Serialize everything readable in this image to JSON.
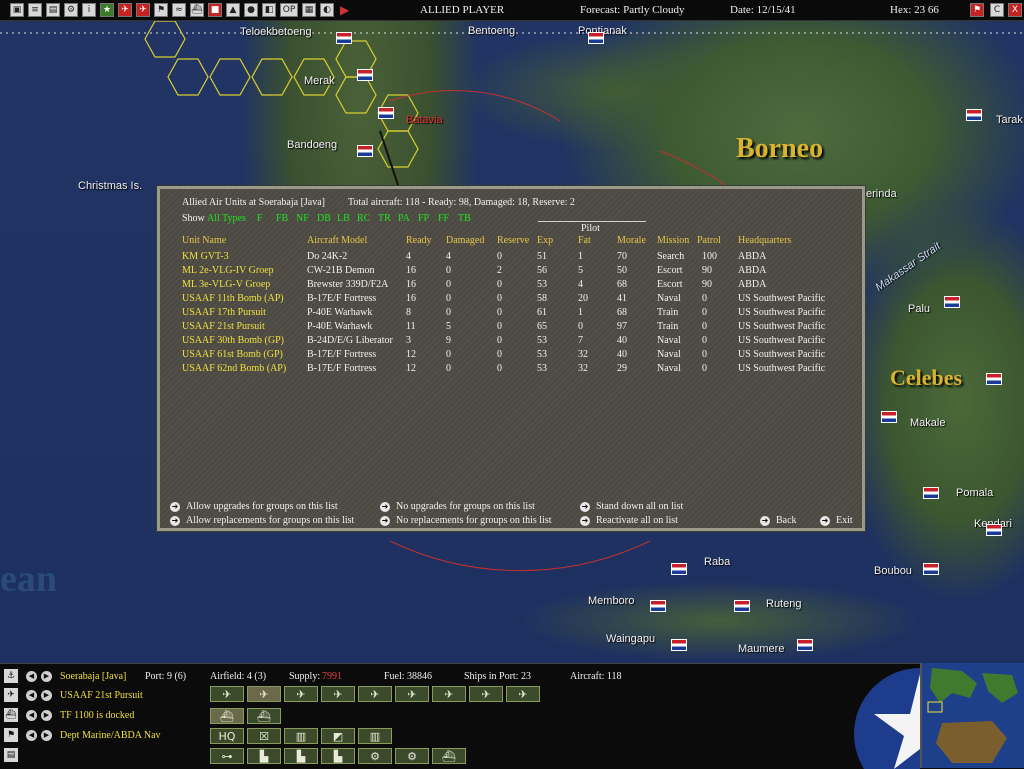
{
  "topbar": {
    "player": "ALLIED PLAYER",
    "forecast": "Forecast: Partly Cloudy",
    "date": "Date: 12/15/41",
    "hex": "Hex: 23 66",
    "corner_buttons": [
      "C",
      "X"
    ]
  },
  "map": {
    "places": [
      "Teloekbetoeng",
      "Bentoeng",
      "Pontianak",
      "Merak",
      "Batavia",
      "Bandoeng",
      "Christmas Is.",
      "Tarak",
      "Palu",
      "Makale",
      "Pomala",
      "Kendari",
      "Boubou",
      "Raba",
      "Memboro",
      "Ruteng",
      "Waingapu",
      "Maumere",
      "erinda",
      "Makassar Strait"
    ],
    "big_labels": [
      "Borneo",
      "Celebes",
      "ean"
    ]
  },
  "dialog": {
    "title": "Allied Air Units at Soerabaja [Java]",
    "totals": "Total aircraft: 118 - Ready: 98, Damaged: 18, Reserve: 2",
    "show_label": "Show",
    "filters": [
      "All Types",
      "F",
      "FB",
      "NF",
      "DB",
      "LB",
      "RC",
      "TR",
      "PA",
      "FP",
      "FF",
      "TB"
    ],
    "pilot_group": "Pilot",
    "columns": [
      "Unit Name",
      "Aircraft Model",
      "Ready",
      "Damaged",
      "Reserve",
      "Exp",
      "Fat",
      "Morale",
      "Mission",
      "Patrol",
      "Headquarters"
    ],
    "rows": [
      [
        "KM GVT-3",
        "Do 24K-2",
        "4",
        "4",
        "0",
        "51",
        "1",
        "70",
        "Search",
        "100",
        "ABDA"
      ],
      [
        "ML 2e-VLG-IV Groep",
        "CW-21B Demon",
        "16",
        "0",
        "2",
        "56",
        "5",
        "50",
        "Escort",
        "90",
        "ABDA"
      ],
      [
        "ML 3e-VLG-V Groep",
        "Brewster 339D/F2A",
        "16",
        "0",
        "0",
        "53",
        "4",
        "68",
        "Escort",
        "90",
        "ABDA"
      ],
      [
        "USAAF 11th Bomb (AP)",
        "B-17E/F Fortress",
        "16",
        "0",
        "0",
        "58",
        "20",
        "41",
        "Naval",
        "0",
        "US Southwest Pacific"
      ],
      [
        "USAAF 17th Pursuit",
        "P-40E Warhawk",
        "8",
        "0",
        "0",
        "61",
        "1",
        "68",
        "Train",
        "0",
        "US Southwest Pacific"
      ],
      [
        "USAAF 21st Pursuit",
        "P-40E Warhawk",
        "11",
        "5",
        "0",
        "65",
        "0",
        "97",
        "Train",
        "0",
        "US Southwest Pacific"
      ],
      [
        "USAAF 30th Bomb (GP)",
        "B-24D/E/G Liberator",
        "3",
        "9",
        "0",
        "53",
        "7",
        "40",
        "Naval",
        "0",
        "US Southwest Pacific"
      ],
      [
        "USAAF 61st Bomb (GP)",
        "B-17E/F Fortress",
        "12",
        "0",
        "0",
        "53",
        "32",
        "40",
        "Naval",
        "0",
        "US Southwest Pacific"
      ],
      [
        "USAAF 62nd Bomb (AP)",
        "B-17E/F Fortress",
        "12",
        "0",
        "0",
        "53",
        "32",
        "29",
        "Naval",
        "0",
        "US Southwest Pacific"
      ]
    ],
    "options": {
      "allow_upgrades": "Allow upgrades for groups on this list",
      "allow_replacements": "Allow replacements for groups on this list",
      "no_upgrades": "No upgrades for groups on this list",
      "no_replacements": "No replacements for groups on this list",
      "stand_down": "Stand down all on list",
      "reactivate": "Reactivate all on list",
      "back": "Back",
      "exit": "Exit"
    }
  },
  "bottom": {
    "base_name": "Soerabaja [Java]",
    "port": "Port: 9 (6)",
    "airfield": "Airfield: 4 (3)",
    "supply_label": "Supply:",
    "supply_value": "7991",
    "fuel": "Fuel: 38846",
    "ships": "Ships in Port: 23",
    "aircraft": "Aircraft: 118",
    "air_unit": "USAAF 21st Pursuit",
    "task_force": "TF 1100 is docked",
    "command": "Dept Marine/ABDA Nav",
    "hq_label": "HQ"
  }
}
